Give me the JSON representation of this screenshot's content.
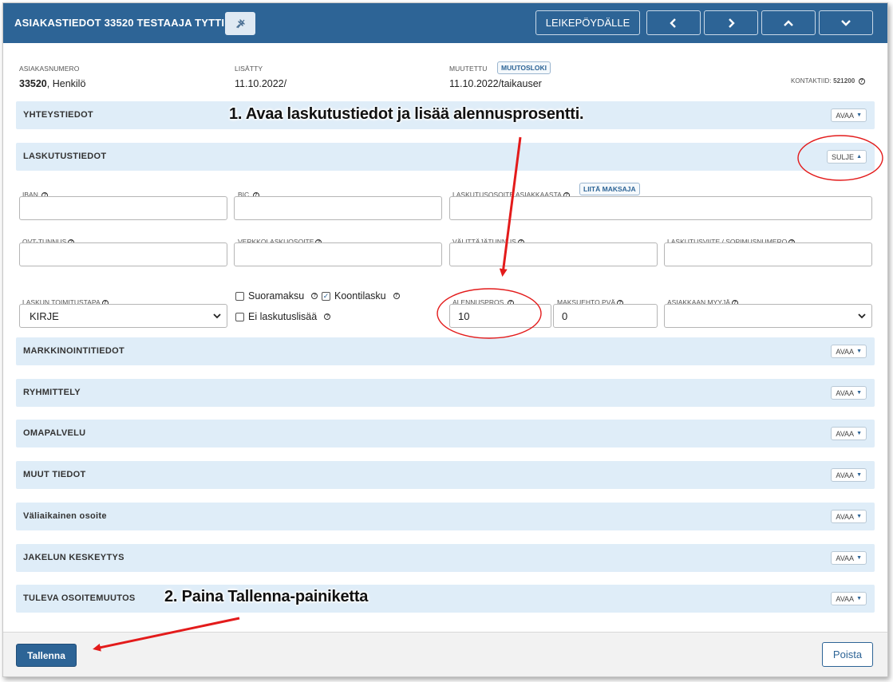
{
  "header": {
    "title": "ASIAKASTIEDOT 33520 TESTAAJA TYTTI",
    "clipboard_label": "LEIKEPÖYDÄLLE"
  },
  "info": {
    "customer_number_label": "ASIAKASNUMERO",
    "customer_number": "33520",
    "customer_type": ", Henkilö",
    "added_label": "LISÄTTY",
    "added_value": "11.10.2022/",
    "modified_label": "MUUTETTU",
    "changelog_label": "MUUTOSLOKI",
    "modified_value": "11.10.2022/taikauser",
    "contact_id_label": "KONTAKTIID:",
    "contact_id": "521200"
  },
  "sections": {
    "contact": "YHTEYSTIEDOT",
    "billing": "LASKUTUSTIEDOT",
    "marketing": "MARKKINOINTITIEDOT",
    "grouping": "RYHMITTELY",
    "self_service": "OMAPALVELU",
    "other": "MUUT TIEDOT",
    "temp_address": "Väliaikainen osoite",
    "delivery_break": "JAKELUN KESKEYTYS",
    "address_change": "TULEVA OSOITEMUUTOS",
    "open_label": "AVAA",
    "close_label": "SULJE"
  },
  "billing": {
    "iban_label": "IBAN.",
    "bic_label": "BIC.",
    "billing_address_label": "LASKUTUSOSOITE ASIAKKAASTA",
    "attach_payer_label": "LIITÄ MAKSAJA",
    "ovt_label": "OVT-TUNNUS",
    "ebilling_label": "VERKKOLASKUOSOITE",
    "operator_label": "VÄLITTÄJÄTUNNUS",
    "reference_label": "LASKUTUSVIITE / SOPIMUSNUMERO",
    "delivery_method_label": "LASKUN TOIMITUSTAPA",
    "delivery_method_value": "KIRJE",
    "direct_payment_label": "Suoramaksu",
    "collective_invoice_label": "Koontilasku",
    "no_surcharge_label": "Ei laskutuslisää",
    "discount_label": "ALENNUSPROS.",
    "discount_value": "10",
    "payment_terms_label": "MAKSUEHTO PVÄ",
    "payment_terms_value": "0",
    "seller_label": "ASIAKKAAN MYYJÄ",
    "seller_value": ""
  },
  "footer": {
    "save_label": "Tallenna",
    "delete_label": "Poista"
  },
  "annotations": {
    "step1": "1. Avaa laskutustiedot ja lisää alennusprosentti.",
    "step2": "2. Paina Tallenna-painiketta"
  },
  "colors": {
    "header_bg": "#2d6496",
    "section_bg": "#dfedf8",
    "annotation_red": "#e31b1b"
  }
}
